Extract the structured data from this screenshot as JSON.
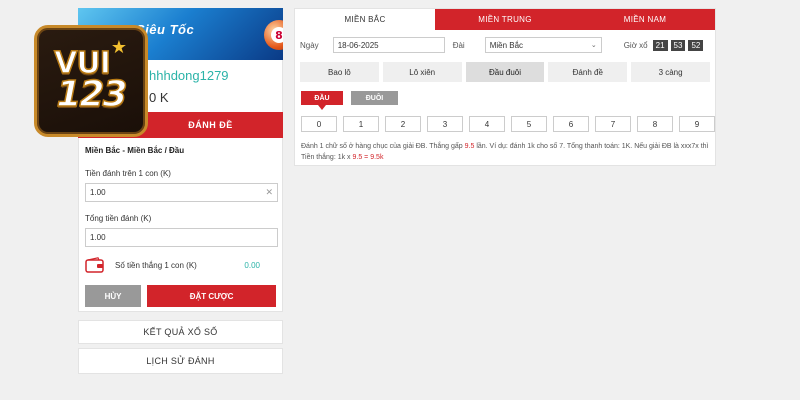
{
  "banner": {
    "text": "Siêu Tốc",
    "ball_number": "8"
  },
  "logo": {
    "line1": "VUI",
    "line2": "123"
  },
  "user": {
    "username": "hhhdong1279",
    "balance": "0 K"
  },
  "left_tab": {
    "label": "ĐÁNH ĐỀ"
  },
  "form": {
    "breadcrumb": "Miền Bắc - Miền Bắc / Đầu",
    "bet_per_label": "Tiền đánh trên 1 con (K)",
    "bet_per_value": "1.00",
    "total_label": "Tổng tiền đánh (K)",
    "total_value": "1.00",
    "win_label": "Số tiền thắng 1 con (K)",
    "win_value": "0.00",
    "cancel_label": "HỦY",
    "place_label": "ĐẶT CƯỢC"
  },
  "links": {
    "results": "KẾT QUẢ XỔ SỐ",
    "history": "LỊCH SỬ ĐÁNH"
  },
  "regions": [
    {
      "label": "MIỀN BẮC"
    },
    {
      "label": "MIỀN TRUNG"
    },
    {
      "label": "MIỀN NAM"
    }
  ],
  "filters": {
    "date_label": "Ngày",
    "date_value": "18-06-2025",
    "dai_label": "Đài",
    "dai_value": "Miền Bắc",
    "time_label": "Giờ xổ",
    "time_h": "21",
    "time_m": "53",
    "time_s": "52"
  },
  "bet_types": [
    {
      "label": "Bao lô"
    },
    {
      "label": "Lô xiên"
    },
    {
      "label": "Đầu đuôi"
    },
    {
      "label": "Đánh đề"
    },
    {
      "label": "3 càng"
    }
  ],
  "sub_tabs": {
    "dau": "ĐẦU",
    "duoi": "ĐUÔI"
  },
  "numbers": [
    "0",
    "1",
    "2",
    "3",
    "4",
    "5",
    "6",
    "7",
    "8",
    "9"
  ],
  "description": {
    "p1": "Đánh 1 chữ số ở hàng chục của giải ĐB. Thắng gấp ",
    "odds": "9.5",
    "p2": " lần. Ví dụ: đánh 1k cho số 7. Tổng thanh toán: 1K. Nếu giải ĐB là xxx7x thì Tiền thắng: 1k x ",
    "calc": "9.5 = 9.5k"
  },
  "colors": {
    "accent_red": "#d2242a",
    "teal": "#2bb3a8",
    "gray_button": "#999999"
  }
}
